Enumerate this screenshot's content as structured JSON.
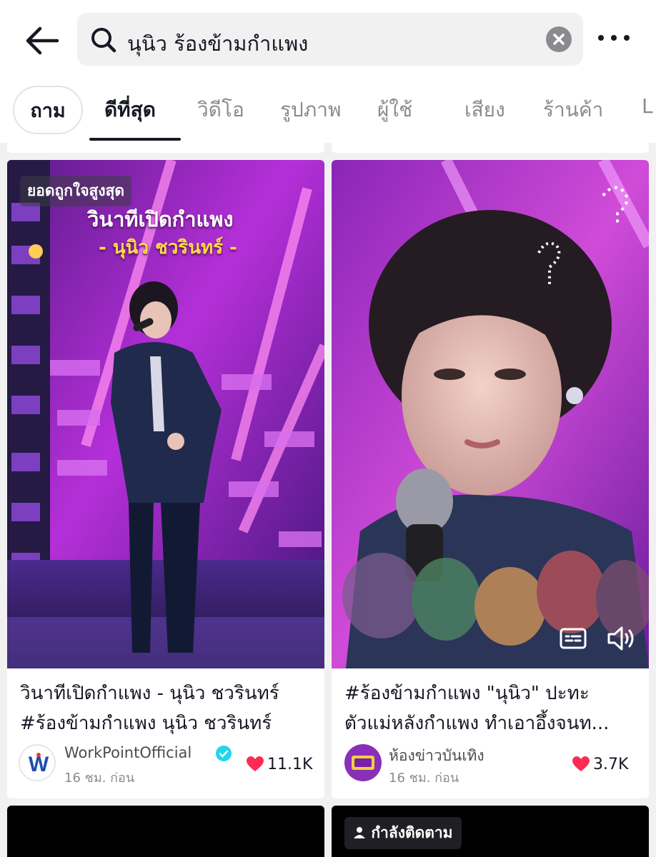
{
  "header": {
    "search_query": "นุนิว ร้องข้ามกำแพง"
  },
  "tabs": [
    {
      "label": "ถาม"
    },
    {
      "label": "ดีที่สุด",
      "active": true
    },
    {
      "label": "วิดีโอ"
    },
    {
      "label": "รูปภาพ"
    },
    {
      "label": "ผู้ใช้"
    },
    {
      "label": "เสียง"
    },
    {
      "label": "ร้านค้า"
    },
    {
      "label": "L"
    }
  ],
  "results": [
    {
      "badge": "ยอดถูกใจสูงสุด",
      "overlay_title": "วินาทีเปิดกำแพง",
      "overlay_subtitle": "- นุนิว ชวรินทร์ -",
      "caption_line1": "วินาทีเปิดกำแพง - นุนิว ชวรินทร์",
      "caption_line2": "#ร้องข้ามกำแพง นุนิว ชวรินทร์",
      "author": "WorkPointOfficial",
      "verified": true,
      "time": "16 ชม. ก่อน",
      "likes": "11.1K",
      "avatar_letter": "W"
    },
    {
      "caption_line1": "#ร้องข้ามกำแพง  \"นุนิว\" ปะทะ",
      "caption_line2": "ตัวแม่หลังกำแพง ทำเอาอึ้งจนท...",
      "author": "ห้องข่าวบันเทิง",
      "verified": false,
      "time": "16 ชม. ก่อน",
      "likes": "3.7K"
    },
    {
      "follow_label": "กำลังติดตาม"
    }
  ],
  "colors": {
    "accent_like": "#fe2c55",
    "verified": "#20d5ec",
    "stage_magenta": "#c42ee0"
  }
}
